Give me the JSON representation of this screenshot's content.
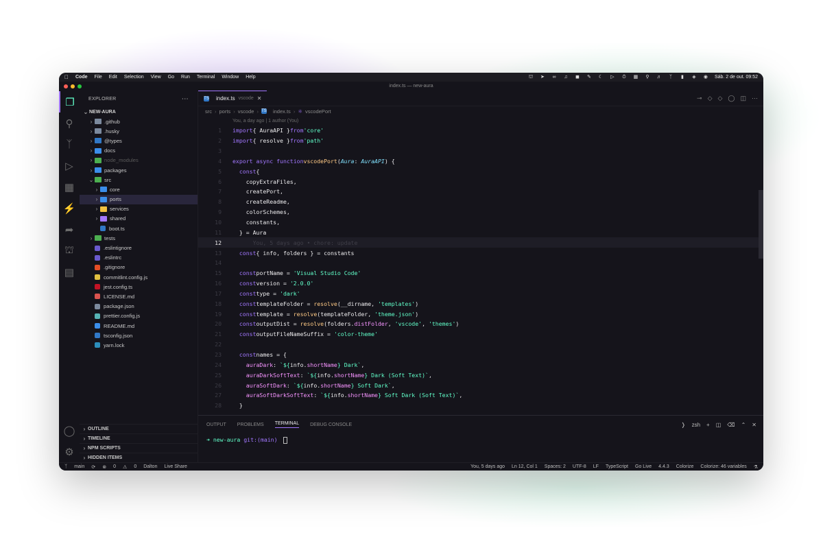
{
  "menubar": {
    "app": "Code",
    "items": [
      "File",
      "Edit",
      "Selection",
      "View",
      "Go",
      "Run",
      "Terminal",
      "Window",
      "Help"
    ],
    "clock": "Sáb. 2 de out.  09:52"
  },
  "window": {
    "title": "index.ts — new-aura"
  },
  "sidebar": {
    "title": "EXPLORER",
    "project": "NEW-AURA",
    "tree": [
      {
        "label": ".github",
        "kind": "folder",
        "depth": 0
      },
      {
        "label": ".husky",
        "kind": "folder",
        "depth": 0
      },
      {
        "label": "@types",
        "kind": "folder",
        "depth": 0
      },
      {
        "label": "docs",
        "kind": "folder",
        "depth": 0
      },
      {
        "label": "node_modules",
        "kind": "folder",
        "depth": 0
      },
      {
        "label": "packages",
        "kind": "folder",
        "depth": 0
      },
      {
        "label": "src",
        "kind": "folder-open",
        "depth": 0
      },
      {
        "label": "core",
        "kind": "folder",
        "depth": 1
      },
      {
        "label": "ports",
        "kind": "folder",
        "depth": 1
      },
      {
        "label": "services",
        "kind": "folder",
        "depth": 1
      },
      {
        "label": "shared",
        "kind": "folder",
        "depth": 1
      },
      {
        "label": "boot.ts",
        "kind": "file",
        "depth": 1
      },
      {
        "label": "tests",
        "kind": "folder",
        "depth": 0
      },
      {
        "label": ".eslintignore",
        "kind": "file",
        "depth": 0
      },
      {
        "label": ".eslintrc",
        "kind": "file",
        "depth": 0
      },
      {
        "label": ".gitignore",
        "kind": "file",
        "depth": 0
      },
      {
        "label": "commitlint.config.js",
        "kind": "file",
        "depth": 0
      },
      {
        "label": "jest.config.ts",
        "kind": "file",
        "depth": 0
      },
      {
        "label": "LICENSE.md",
        "kind": "file",
        "depth": 0
      },
      {
        "label": "package.json",
        "kind": "file",
        "depth": 0
      },
      {
        "label": "prettier.config.js",
        "kind": "file",
        "depth": 0
      },
      {
        "label": "README.md",
        "kind": "file",
        "depth": 0
      },
      {
        "label": "tsconfig.json",
        "kind": "file",
        "depth": 0
      },
      {
        "label": "yarn.lock",
        "kind": "file",
        "depth": 0
      }
    ],
    "sections": [
      "OUTLINE",
      "TIMELINE",
      "NPM SCRIPTS",
      "HIDDEN ITEMS"
    ]
  },
  "editor": {
    "tab": {
      "name": "index.ts",
      "sub": "vscode"
    },
    "breadcrumb": [
      "src",
      "ports",
      "vscode",
      "index.ts",
      "vscodePort"
    ],
    "codelens": "You, a day ago | 1 author (You)",
    "blame": "You, 5 days ago • chore: update"
  },
  "terminal": {
    "tabs": [
      "OUTPUT",
      "PROBLEMS",
      "TERMINAL",
      "DEBUG CONSOLE"
    ],
    "shell": "zsh",
    "prompt_dir": "new-aura",
    "prompt_branch": "git:(main)"
  },
  "statusbar": {
    "branch": "main",
    "errors": "0",
    "warnings": "0",
    "user": "Dalton",
    "liveshare": "Live Share",
    "blame": "You, 5 days ago",
    "position": "Ln 12, Col 1",
    "spaces": "Spaces: 2",
    "encoding": "UTF-8",
    "eol": "LF",
    "language": "TypeScript",
    "golive": "Go Live",
    "version": "4.4.3",
    "colorize": "Colorize",
    "colorize_vars": "Colorize: 46 variables"
  },
  "colors": {
    "accent": "#a277ff",
    "green": "#61ffca",
    "orange": "#ffca85",
    "pink": "#f694ff",
    "background": "#15141b"
  }
}
